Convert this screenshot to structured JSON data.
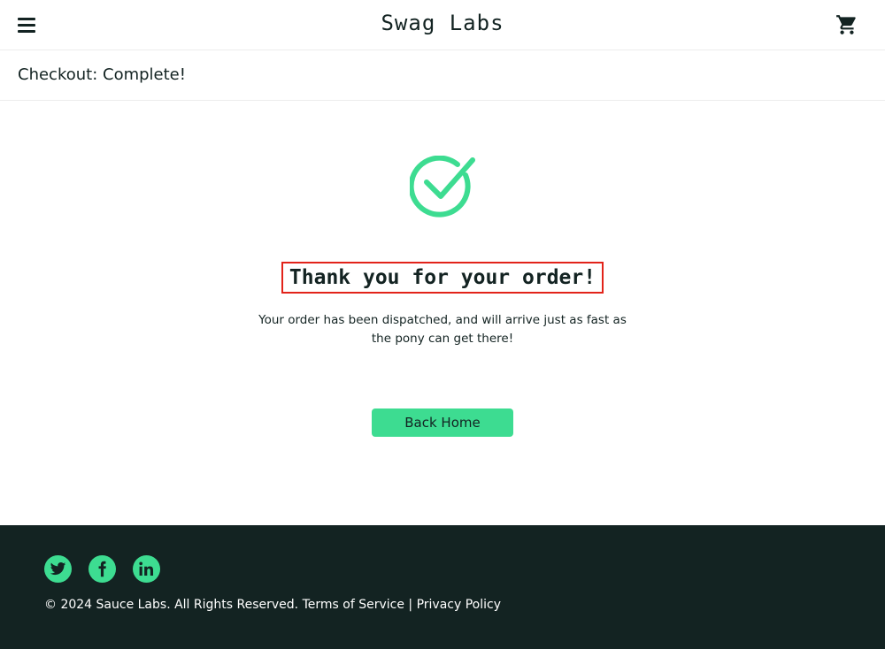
{
  "header": {
    "app_logo": "Swag Labs",
    "menu_icon": "hamburger-menu-icon",
    "cart_icon": "shopping-cart-icon"
  },
  "secondary_header": {
    "title": "Checkout: Complete!"
  },
  "checkout_complete": {
    "icon": "checkmark-circle-icon",
    "header": "Thank you for your order!",
    "text": "Your order has been dispatched, and will arrive just as fast as the pony can get there!",
    "back_home_label": "Back Home"
  },
  "footer": {
    "social": [
      "twitter-icon",
      "facebook-icon",
      "linkedin-icon"
    ],
    "copy": "© 2024 Sauce Labs. All Rights Reserved.",
    "terms": "Terms of Service",
    "separator": "|",
    "privacy": "Privacy Policy"
  },
  "colors": {
    "accent": "#3ddc91",
    "dark": "#132322",
    "highlight_border": "#e2231a",
    "divider": "#ededed"
  }
}
